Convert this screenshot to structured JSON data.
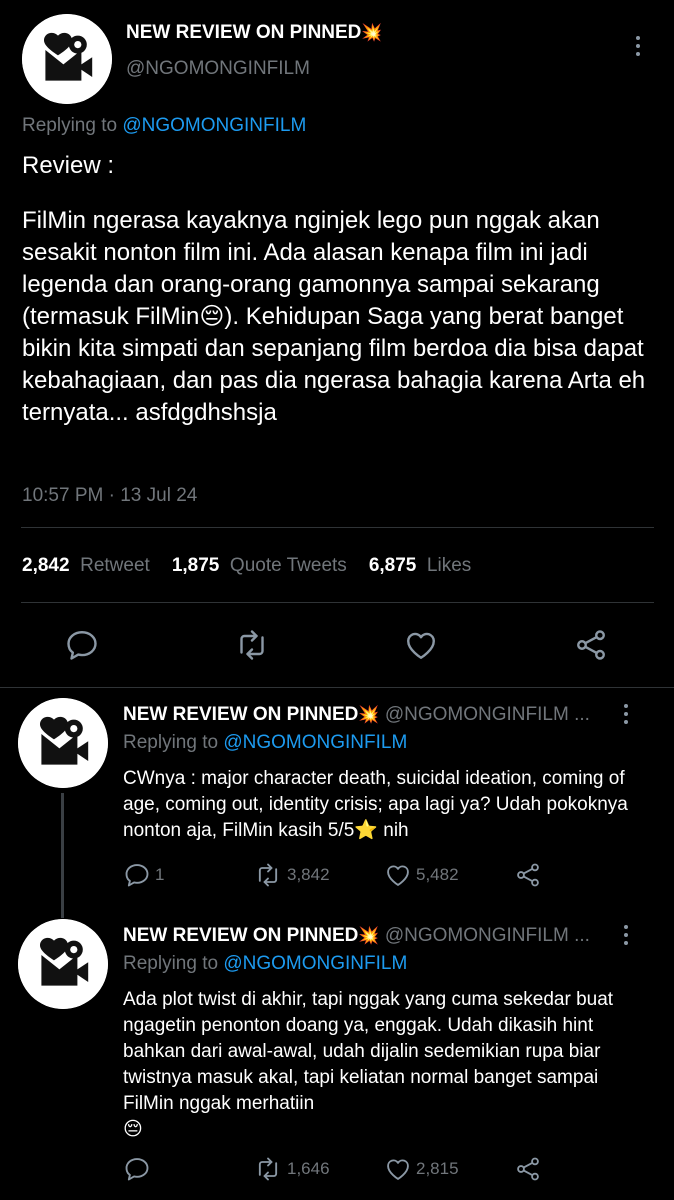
{
  "main_tweet": {
    "author_name": "NEW REVIEW ON PINNED",
    "author_emoji": "💥",
    "handle": "@NGOMONGINFILM",
    "replying_to_label": "Replying to",
    "replying_to_handle": "@NGOMONGINFILM",
    "heading": "Review :",
    "body_before_emoji": "FilMin ngerasa kayaknya nginjek lego pun nggak akan sesakit nonton film ini. Ada alasan kenapa film ini jadi legenda dan orang-orang gamonnya sampai sekarang (termasuk FilMin",
    "body_emoji": "😔",
    "body_after_emoji": "). Kehidupan Saga yang berat banget bikin kita simpati dan sepanjang film berdoa dia bisa dapat kebahagiaan, dan pas dia ngerasa bahagia karena Arta eh ternyata... asfdgdhshsja",
    "timestamp": "10:57 PM · 13 Jul 24",
    "stats": {
      "retweets": "2,842",
      "retweets_label": "Retweet",
      "quotes": "1,875",
      "quotes_label": "Quote Tweets",
      "likes": "6,875",
      "likes_label": "Likes"
    }
  },
  "replies": [
    {
      "author_name": "NEW REVIEW ON PINNED",
      "author_emoji": "💥",
      "handle": "@NGOMONGINFILM ...",
      "replying_to_label": "Replying to",
      "replying_to_handle": "@NGOMONGINFILM",
      "body": "CWnya : major character death, suicidal ideation, coming of age, coming out, identity crisis; apa lagi ya? Udah pokoknya nonton aja, FilMin kasih 5/5",
      "body_emoji": "⭐",
      "body_tail": " nih",
      "reply_count": "1",
      "retweet_count": "3,842",
      "like_count": "5,482"
    },
    {
      "author_name": "NEW REVIEW ON PINNED",
      "author_emoji": "💥",
      "handle": "@NGOMONGINFILM ...",
      "replying_to_label": "Replying to",
      "replying_to_handle": "@NGOMONGINFILM",
      "body": "Ada plot twist di akhir, tapi nggak yang cuma sekedar buat ngagetin penonton doang ya, enggak. Udah dikasih hint bahkan dari awal-awal, udah dijalin sedemikian rupa biar twistnya masuk akal, tapi keliatan normal banget sampai FilMin nggak merhatiin",
      "body_emoji": "😔",
      "body_tail": "",
      "reply_count": "",
      "retweet_count": "1,646",
      "like_count": "2,815"
    }
  ],
  "icons": {
    "avatar": "film-heart-envelope-logo",
    "reply": "reply-icon",
    "retweet": "retweet-icon",
    "like": "heart-icon",
    "share": "share-icon",
    "more": "more-vertical-icon"
  },
  "colors": {
    "background": "#000000",
    "text": "#e7e9ea",
    "muted": "#71767b",
    "link": "#1d9bf0",
    "divider": "#2f3336"
  }
}
